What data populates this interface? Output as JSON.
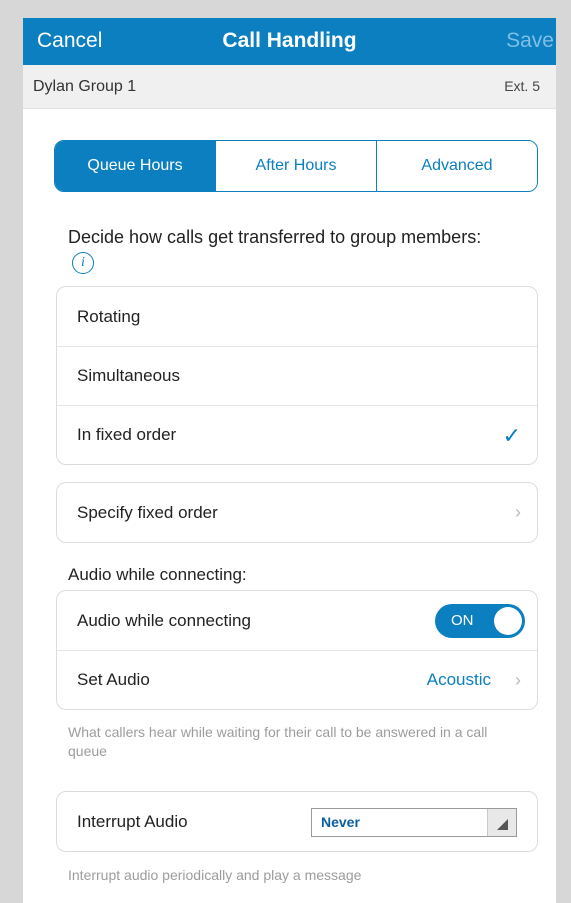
{
  "header": {
    "cancel_label": "Cancel",
    "title": "Call Handling",
    "save_label": "Save"
  },
  "subheader": {
    "group_name": "Dylan Group 1",
    "extension": "Ext. 5"
  },
  "tabs": [
    {
      "label": "Queue Hours",
      "active": true
    },
    {
      "label": "After Hours",
      "active": false
    },
    {
      "label": "Advanced",
      "active": false
    }
  ],
  "description": {
    "text": "Decide how calls get transferred to group members:",
    "info_icon": "i"
  },
  "transfer_options": [
    {
      "label": "Rotating",
      "selected": false
    },
    {
      "label": "Simultaneous",
      "selected": false
    },
    {
      "label": "In fixed order",
      "selected": true
    }
  ],
  "check_glyph": "✓",
  "fixed_order": {
    "label": "Specify fixed order"
  },
  "audio": {
    "section_label": "Audio while connecting:",
    "toggle_label": "Audio while connecting",
    "toggle_state": "ON",
    "set_audio_label": "Set Audio",
    "set_audio_value": "Acoustic",
    "help_text": "What callers hear while waiting for their call to be answered in a call queue"
  },
  "interrupt": {
    "label": "Interrupt Audio",
    "selected_value": "Never",
    "help_text": "Interrupt audio periodically and play a message"
  },
  "colors": {
    "accent": "#0b7fc0",
    "save_disabled": "#7fbfe6"
  }
}
